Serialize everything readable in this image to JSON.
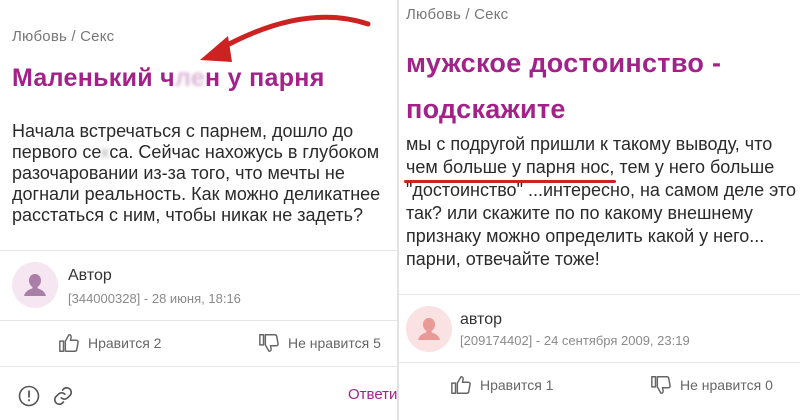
{
  "left": {
    "breadcrumb": "Любовь / Секс",
    "title_start": "Маленький ч",
    "title_hidden": "ле",
    "title_end": "н у парня",
    "body_lines": [
      [
        "Начала встречаться с парнем, дошло до"
      ],
      [
        "первого се",
        "к",
        "са. Сейчас нахожусь в глубоком"
      ],
      [
        "разочаровании из-за того, что мечты не"
      ],
      [
        "догнали реальность. Как можно деликатнее"
      ],
      [
        "расстаться с ним, чтобы никак не задеть?"
      ]
    ],
    "author_label": "Автор",
    "author_meta": "[344000328] - 28 июня, 18:16",
    "like_label": "Нравится 2",
    "dislike_label": "Не нравится 5",
    "answer_label": "Ответить"
  },
  "right": {
    "breadcrumb": "Любовь / Секс",
    "title_lines": [
      "мужское достоинство -",
      "подскажите"
    ],
    "body_lines": [
      "мы с подругой пришли к такому выводу, что",
      "чем больше у парня нос, тем у него больше",
      "\"достоинство\" ...интересно, на самом деле это",
      "так? или скажите по по какому внешнему",
      "признаку можно определить какой у него...",
      "парни, отвечайте тоже!"
    ],
    "author_label": "автор",
    "author_meta": "[209174402] - 24 сентября 2009, 23:19",
    "like_label": "Нравится 1",
    "dislike_label": "Не нравится 0"
  },
  "colors": {
    "title": "#a3228a",
    "arrow": "#cc2222",
    "underline": "#cc2222",
    "avatar_left_bg": "#f6e6f1",
    "avatar_left_fg": "#a97fa8",
    "avatar_right_bg": "#f9e2e1",
    "avatar_right_fg": "#e89a97"
  }
}
